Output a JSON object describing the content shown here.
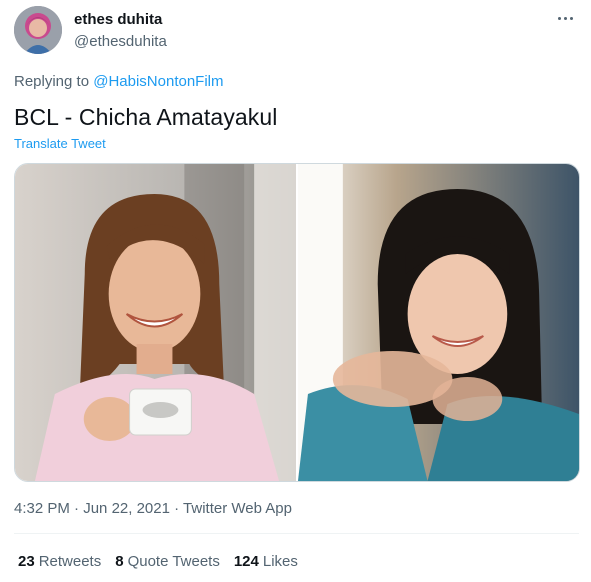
{
  "user": {
    "display_name": "ethes duhita",
    "handle": "@ethesduhita"
  },
  "reply": {
    "prefix": "Replying to ",
    "mention": "@HabisNontonFilm"
  },
  "tweet": {
    "text": "BCL - Chicha Amatayakul",
    "translate_label": "Translate Tweet"
  },
  "meta": {
    "time": "4:32 PM",
    "sep1": " · ",
    "date": "Jun 22, 2021",
    "sep2": " · ",
    "source": "Twitter Web App"
  },
  "stats": {
    "retweets_count": "23",
    "retweets_label": "Retweets",
    "quotes_count": "8",
    "quotes_label": "Quote Tweets",
    "likes_count": "124",
    "likes_label": "Likes"
  },
  "icons": {
    "more": "more-dots-icon"
  },
  "colors": {
    "accent": "#1d9bf0",
    "text_primary": "#0f1419",
    "text_secondary": "#536471",
    "border": "#cfd9de"
  }
}
